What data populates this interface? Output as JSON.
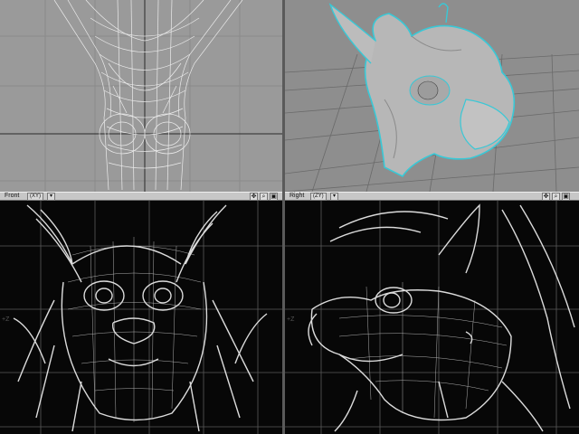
{
  "viewports": {
    "top": {
      "background": "#9a9a9a"
    },
    "perspective": {
      "background": "#8e8e8e"
    },
    "front": {
      "label": "Front",
      "mode": "(XY)",
      "background": "#070707"
    },
    "right": {
      "label": "Right",
      "mode": "(ZY)",
      "background": "#070707"
    }
  },
  "toolbar": {
    "dropdown_arrow": "▾",
    "move_icon_glyph": "✥",
    "zoom_icon_glyph": "⌕",
    "maximize_icon_glyph": "▣"
  },
  "axis_labels": {
    "left_z": "+Z",
    "right_z": "+Z"
  },
  "colors": {
    "wire_light": "#f2f2f2",
    "selection_cyan": "#39c8d6",
    "grid_dark": "#3a3a3a",
    "grid_light": "#7a7a7a"
  }
}
